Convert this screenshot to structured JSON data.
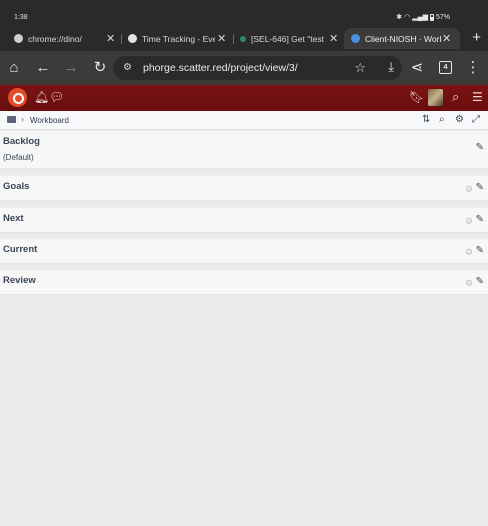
{
  "status_bar": {
    "time": "1:38",
    "battery": "57%"
  },
  "tabs": [
    {
      "title": "chrome://dino/",
      "favicon_color": "#cfcfcf",
      "active": false
    },
    {
      "title": "Time Tracking - Even",
      "favicon_color": "#e3e3e3",
      "active": false
    },
    {
      "title": "[SEL-646] Get \"test r",
      "favicon_color": "#2b8a6e",
      "active": false
    },
    {
      "title": "Client-NIOSH · Work",
      "favicon_color": "#4a90e2",
      "active": true
    }
  ],
  "toolbar": {
    "url": "phorge.scatter.red/project/view/3/",
    "tab_count": "4"
  },
  "app_header": {
    "brand_color": "#7a1313"
  },
  "crumbs": {
    "current": "Workboard"
  },
  "columns": [
    {
      "name": "Backlog",
      "subtitle": "(Default)"
    },
    {
      "name": "Goals",
      "subtitle": ""
    },
    {
      "name": "Next",
      "subtitle": ""
    },
    {
      "name": "Current",
      "subtitle": ""
    },
    {
      "name": "Review",
      "subtitle": ""
    }
  ]
}
